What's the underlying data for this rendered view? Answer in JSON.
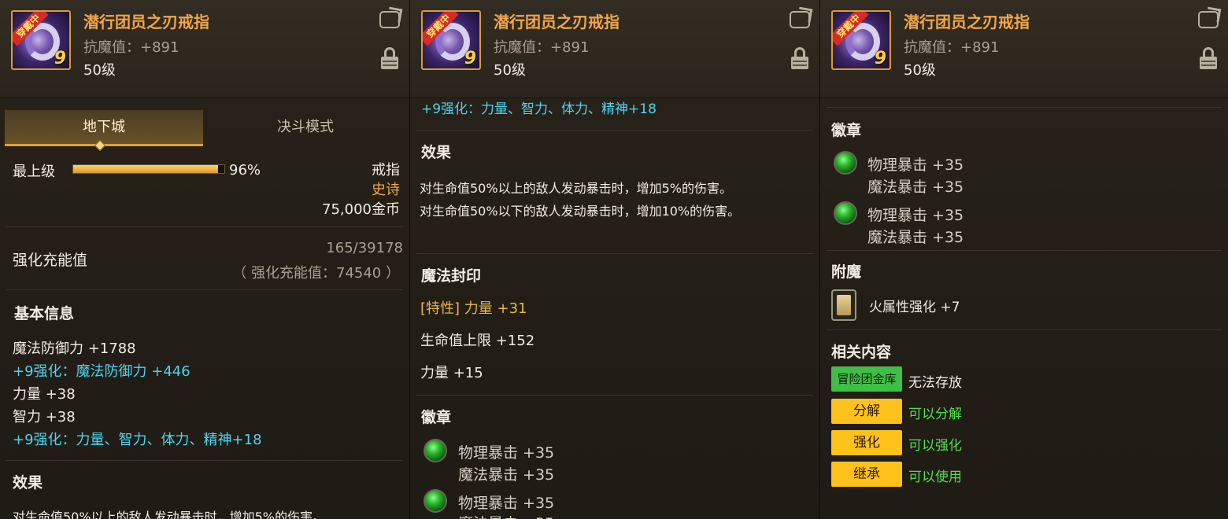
{
  "item": {
    "name": "潜行团员之刃戒指",
    "stat": "抗魔值：+891",
    "level": "50级",
    "badge": "穿戴中",
    "enhance_level": "9"
  },
  "tabs": [
    "地下城",
    "决斗模式"
  ],
  "quality": {
    "label": "最上级",
    "percent_text": "96%",
    "percent": 96,
    "type": "戒指",
    "rarity": "史诗",
    "price": "75,000金币"
  },
  "charge": {
    "label": "强化充能值",
    "value": "165/39178",
    "total": "（ 强化充能值：74540 ）"
  },
  "basic": {
    "title": "基本信息",
    "lines": [
      "魔法防御力 +1788",
      "+9强化：魔法防御力 +446",
      "力量 +38",
      "智力 +38",
      "+9强化：力量、智力、体力、精神+18"
    ]
  },
  "effect": {
    "title": "效果",
    "line1": "对生命值50%以上的敌人发动暴击时，增加5%的伤害。",
    "line2": "对生命值50%以下的敌人发动暴击时，增加10%的伤害。"
  },
  "seal": {
    "title": "魔法封印",
    "lines": [
      "[特性] 力量 +31",
      "生命值上限 +152",
      "力量 +15"
    ]
  },
  "emblem": {
    "title": "徽章",
    "slots": [
      {
        "a": "物理暴击 +35",
        "b": "魔法暴击 +35"
      },
      {
        "a": "物理暴击 +35",
        "b": "魔法暴击 +35"
      }
    ]
  },
  "enchant": {
    "title": "附魔",
    "value": "火属性强化 +7"
  },
  "related": {
    "title": "相关内容",
    "rows": [
      {
        "button": "冒险团金库",
        "status": "无法存放"
      },
      {
        "button": "分解",
        "status": "可以分解"
      },
      {
        "button": "强化",
        "status": "可以强化"
      },
      {
        "button": "继承",
        "status": "可以使用"
      }
    ]
  },
  "colors": {
    "title": "#f0a64a",
    "enhance_text": "#4fd4f0",
    "button_yellow": "#ffc21a",
    "button_green": "#3fbf46",
    "status_green": "#4fe04f"
  }
}
